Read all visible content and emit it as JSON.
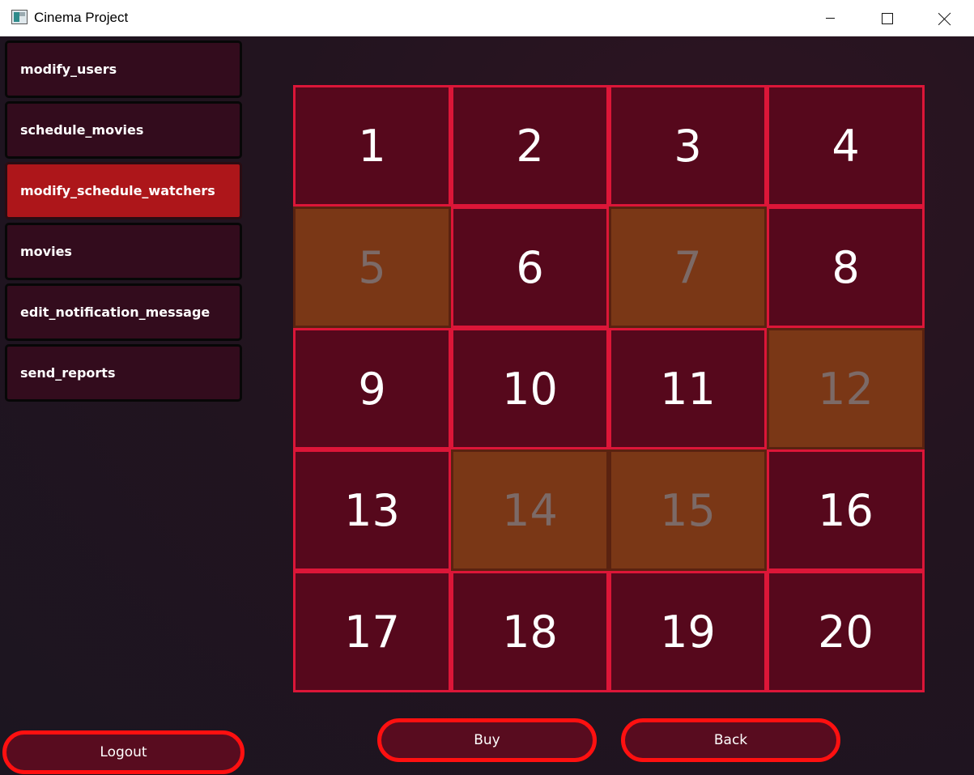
{
  "window": {
    "title": "Cinema Project"
  },
  "sidebar": {
    "items": [
      {
        "label": "modify_users",
        "active": false
      },
      {
        "label": "schedule_movies",
        "active": false
      },
      {
        "label": "modify_schedule_watchers",
        "active": true
      },
      {
        "label": "movies",
        "active": false
      },
      {
        "label": "edit_notification_message",
        "active": false
      },
      {
        "label": "send_reports",
        "active": false
      }
    ],
    "logout_label": "Logout"
  },
  "seats": [
    {
      "number": "1",
      "taken": false
    },
    {
      "number": "2",
      "taken": false
    },
    {
      "number": "3",
      "taken": false
    },
    {
      "number": "4",
      "taken": false
    },
    {
      "number": "5",
      "taken": true
    },
    {
      "number": "6",
      "taken": false
    },
    {
      "number": "7",
      "taken": true
    },
    {
      "number": "8",
      "taken": false
    },
    {
      "number": "9",
      "taken": false
    },
    {
      "number": "10",
      "taken": false
    },
    {
      "number": "11",
      "taken": false
    },
    {
      "number": "12",
      "taken": true
    },
    {
      "number": "13",
      "taken": false
    },
    {
      "number": "14",
      "taken": true
    },
    {
      "number": "15",
      "taken": true
    },
    {
      "number": "16",
      "taken": false
    },
    {
      "number": "17",
      "taken": false
    },
    {
      "number": "18",
      "taken": false
    },
    {
      "number": "19",
      "taken": false
    },
    {
      "number": "20",
      "taken": false
    }
  ],
  "actions": {
    "buy_label": "Buy",
    "back_label": "Back"
  },
  "colors": {
    "seat_available": "#56081c",
    "seat_taken": "#7a3716",
    "seat_border": "#dc1638",
    "nav_active": "#ad161a",
    "button_outline": "#ff1010"
  }
}
